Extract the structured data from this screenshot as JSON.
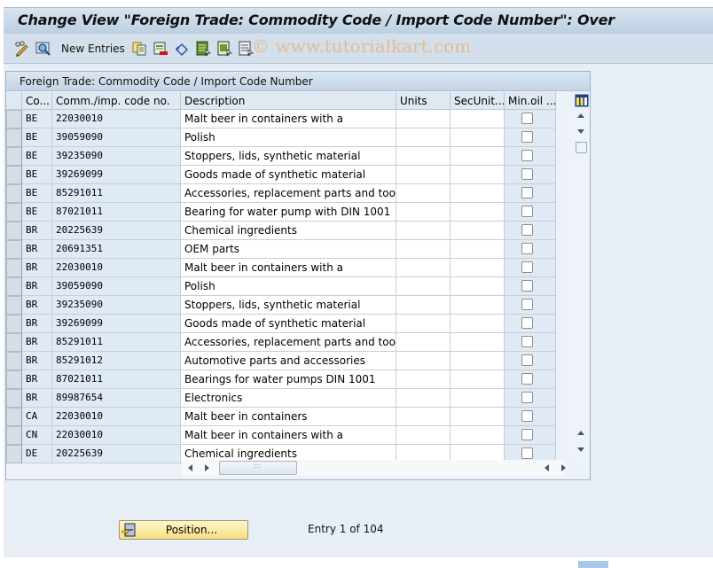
{
  "window": {
    "title": "Change View \"Foreign Trade: Commodity Code / Import Code Number\": Over"
  },
  "toolbar": {
    "watermark": "© www.tutorialkart.com",
    "new_entries_label": "New Entries",
    "icons": [
      "display-change-icon",
      "details-icon",
      "copy-as-icon",
      "delete-icon",
      "undo-change-icon",
      "select-all-icon",
      "select-block-icon",
      "deselect-all-icon"
    ]
  },
  "table": {
    "title": "Foreign Trade: Commodity Code / Import Code Number",
    "columns": [
      "Co...",
      "Comm./imp. code no.",
      "Description",
      "Units",
      "SecUnit...",
      "Min.oil ..."
    ],
    "rows": [
      {
        "country": "BE",
        "code": "22030010",
        "description": "Malt beer in containers with a",
        "units": "",
        "sec_unit": "",
        "min_oil": false
      },
      {
        "country": "BE",
        "code": "39059090",
        "description": "Polish",
        "units": "",
        "sec_unit": "",
        "min_oil": false
      },
      {
        "country": "BE",
        "code": "39235090",
        "description": "Stoppers, lids, synthetic material",
        "units": "",
        "sec_unit": "",
        "min_oil": false
      },
      {
        "country": "BE",
        "code": "39269099",
        "description": "Goods made of synthetic material",
        "units": "",
        "sec_unit": "",
        "min_oil": false
      },
      {
        "country": "BE",
        "code": "85291011",
        "description": "Accessories, replacement parts and tools",
        "units": "",
        "sec_unit": "",
        "min_oil": false
      },
      {
        "country": "BE",
        "code": "87021011",
        "description": "Bearing for water pump with DIN 1001",
        "units": "",
        "sec_unit": "",
        "min_oil": false
      },
      {
        "country": "BR",
        "code": "20225639",
        "description": "Chemical ingredients",
        "units": "",
        "sec_unit": "",
        "min_oil": false
      },
      {
        "country": "BR",
        "code": "20691351",
        "description": "OEM parts",
        "units": "",
        "sec_unit": "",
        "min_oil": false
      },
      {
        "country": "BR",
        "code": "22030010",
        "description": "Malt beer in containers with a",
        "units": "",
        "sec_unit": "",
        "min_oil": false
      },
      {
        "country": "BR",
        "code": "39059090",
        "description": "Polish",
        "units": "",
        "sec_unit": "",
        "min_oil": false
      },
      {
        "country": "BR",
        "code": "39235090",
        "description": "Stoppers, lids, synthetic material",
        "units": "",
        "sec_unit": "",
        "min_oil": false
      },
      {
        "country": "BR",
        "code": "39269099",
        "description": "Goods made of synthetic material",
        "units": "",
        "sec_unit": "",
        "min_oil": false
      },
      {
        "country": "BR",
        "code": "85291011",
        "description": "Accessories, replacement parts and tools",
        "units": "",
        "sec_unit": "",
        "min_oil": false
      },
      {
        "country": "BR",
        "code": "85291012",
        "description": "Automotive parts and accessories",
        "units": "",
        "sec_unit": "",
        "min_oil": false
      },
      {
        "country": "BR",
        "code": "87021011",
        "description": "Bearings for water pumps DIN 1001",
        "units": "",
        "sec_unit": "",
        "min_oil": false
      },
      {
        "country": "BR",
        "code": "89987654",
        "description": "Electronics",
        "units": "",
        "sec_unit": "",
        "min_oil": false
      },
      {
        "country": "CA",
        "code": "22030010",
        "description": "Malt beer in containers",
        "units": "",
        "sec_unit": "",
        "min_oil": false
      },
      {
        "country": "CN",
        "code": "22030010",
        "description": "Malt beer in containers with a",
        "units": "",
        "sec_unit": "",
        "min_oil": false
      },
      {
        "country": "DE",
        "code": "20225639",
        "description": "Chemical ingredients",
        "units": "",
        "sec_unit": "",
        "min_oil": false
      }
    ]
  },
  "footer": {
    "position_button_label": "Position...",
    "entry_info": "Entry 1 of 104"
  }
}
